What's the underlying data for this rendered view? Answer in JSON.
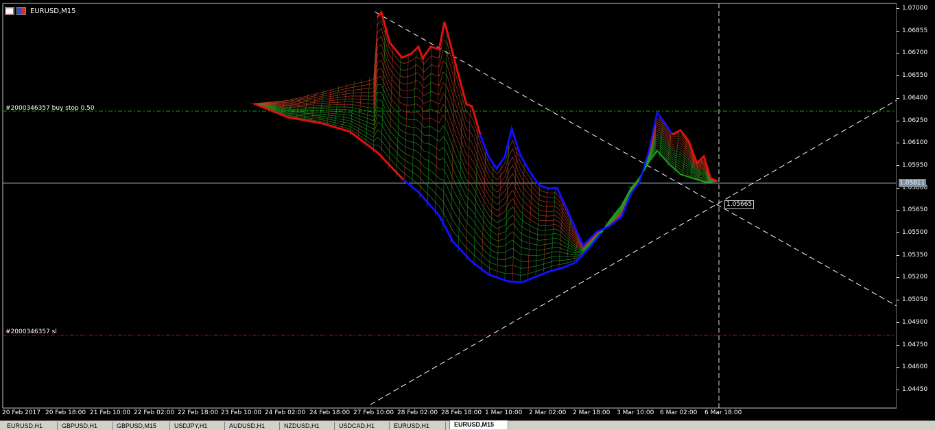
{
  "window": {
    "symbol": "EURUSD,M15",
    "icon_names": [
      "chart-window-icon",
      "flag-icon"
    ]
  },
  "price_axis": {
    "ticks": [
      "1.07000",
      "1.06855",
      "1.06700",
      "1.06550",
      "1.06400",
      "1.06250",
      "1.06100",
      "1.05950",
      "1.05800",
      "1.05650",
      "1.05500",
      "1.05350",
      "1.05200",
      "1.05050",
      "1.04900",
      "1.04750",
      "1.04600",
      "1.04450"
    ],
    "current_price": "1.05811",
    "crosshair_price": "1.05665"
  },
  "time_axis": {
    "ticks": [
      "20 Feb 2017",
      "20 Feb 18:00",
      "21 Feb 10:00",
      "22 Feb 02:00",
      "22 Feb 18:00",
      "23 Feb 10:00",
      "24 Feb 02:00",
      "24 Feb 18:00",
      "27 Feb 10:00",
      "28 Feb 02:00",
      "28 Feb 18:00",
      "1 Mar 10:00",
      "2 Mar 02:00",
      "2 Mar 18:00",
      "3 Mar 10:00",
      "6 Mar 02:00",
      "6 Mar 18:00"
    ]
  },
  "order_lines": {
    "buy_stop_label": "#2000346357 buy stop 0.50",
    "sl_label": "#2000346357 sl",
    "buy_stop_color": "#00b000",
    "sl_color": "#e00000"
  },
  "colors": {
    "background": "#000000",
    "upper_band": "#e01010",
    "lower_band": "#1010ff",
    "mesh_red": "#c04020",
    "mesh_green": "#20a020",
    "trendlines": "#ffffff",
    "current_price_line": "#8fa8b8"
  },
  "tabs": [
    {
      "label": "EURUSD,H1",
      "active": false
    },
    {
      "label": "GBPUSD,H1",
      "active": false
    },
    {
      "label": "GBPUSD,M15",
      "active": false
    },
    {
      "label": "USDJPY,H1",
      "active": false
    },
    {
      "label": "AUDUSD,H1",
      "active": false
    },
    {
      "label": "NZDUSD,H1",
      "active": false
    },
    {
      "label": "USDCAD,H1",
      "active": false
    },
    {
      "label": "EURUSD,H1",
      "active": false
    },
    {
      "label": "EURUSD,M15",
      "active": true
    }
  ]
}
